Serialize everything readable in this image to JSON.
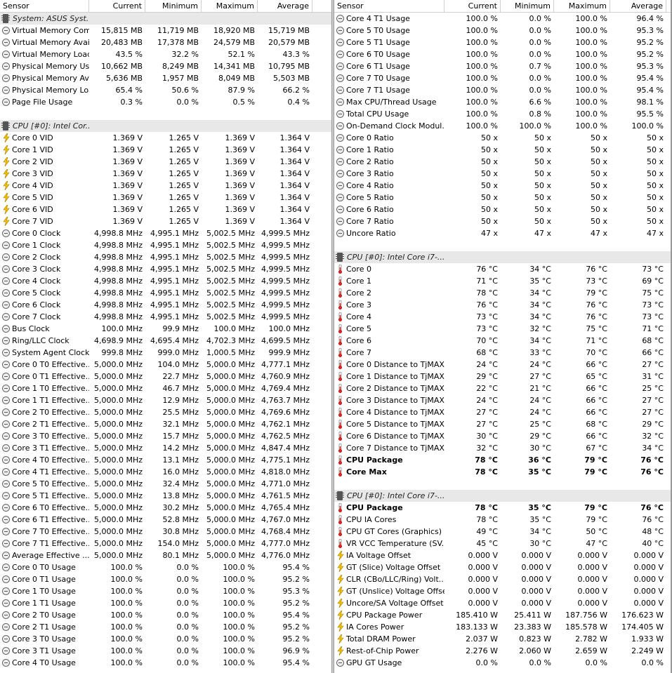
{
  "left": {
    "header": {
      "sensor": "Sensor",
      "current": "Current",
      "minimum": "Minimum",
      "maximum": "Maximum",
      "average": "Average"
    },
    "rows": [
      {
        "t": "group",
        "icon": "chip",
        "name": "System: ASUS Syst..."
      },
      {
        "icon": "circle",
        "name": "Virtual Memory Com...",
        "cur": "15,815 MB",
        "min": "11,719 MB",
        "max": "18,920 MB",
        "avg": "15,719 MB"
      },
      {
        "icon": "circle",
        "name": "Virtual Memory Avai...",
        "cur": "20,483 MB",
        "min": "17,378 MB",
        "max": "24,579 MB",
        "avg": "20,579 MB"
      },
      {
        "icon": "circle",
        "name": "Virtual Memory Load",
        "cur": "43.5 %",
        "min": "32.2 %",
        "max": "52.1 %",
        "avg": "43.3 %"
      },
      {
        "icon": "circle",
        "name": "Physical Memory Used",
        "cur": "10,662 MB",
        "min": "8,249 MB",
        "max": "14,341 MB",
        "avg": "10,795 MB"
      },
      {
        "icon": "circle",
        "name": "Physical Memory Av...",
        "cur": "5,636 MB",
        "min": "1,957 MB",
        "max": "8,049 MB",
        "avg": "5,503 MB"
      },
      {
        "icon": "circle",
        "name": "Physical Memory Load",
        "cur": "65.4 %",
        "min": "50.6 %",
        "max": "87.9 %",
        "avg": "66.2 %"
      },
      {
        "icon": "circle",
        "name": "Page File Usage",
        "cur": "0.3 %",
        "min": "0.0 %",
        "max": "0.5 %",
        "avg": "0.4 %"
      },
      {
        "t": "blank"
      },
      {
        "t": "group",
        "icon": "chip",
        "name": "CPU [#0]: Intel Cor..."
      },
      {
        "icon": "bolt",
        "name": "Core 0 VID",
        "cur": "1.369 V",
        "min": "1.265 V",
        "max": "1.369 V",
        "avg": "1.364 V"
      },
      {
        "icon": "bolt",
        "name": "Core 1 VID",
        "cur": "1.369 V",
        "min": "1.265 V",
        "max": "1.369 V",
        "avg": "1.364 V"
      },
      {
        "icon": "bolt",
        "name": "Core 2 VID",
        "cur": "1.369 V",
        "min": "1.265 V",
        "max": "1.369 V",
        "avg": "1.364 V"
      },
      {
        "icon": "bolt",
        "name": "Core 3 VID",
        "cur": "1.369 V",
        "min": "1.265 V",
        "max": "1.369 V",
        "avg": "1.364 V"
      },
      {
        "icon": "bolt",
        "name": "Core 4 VID",
        "cur": "1.369 V",
        "min": "1.265 V",
        "max": "1.369 V",
        "avg": "1.364 V"
      },
      {
        "icon": "bolt",
        "name": "Core 5 VID",
        "cur": "1.369 V",
        "min": "1.265 V",
        "max": "1.369 V",
        "avg": "1.364 V"
      },
      {
        "icon": "bolt",
        "name": "Core 6 VID",
        "cur": "1.369 V",
        "min": "1.265 V",
        "max": "1.369 V",
        "avg": "1.364 V"
      },
      {
        "icon": "bolt",
        "name": "Core 7 VID",
        "cur": "1.369 V",
        "min": "1.265 V",
        "max": "1.369 V",
        "avg": "1.364 V"
      },
      {
        "icon": "circle",
        "name": "Core 0 Clock",
        "cur": "4,998.8 MHz",
        "min": "4,995.1 MHz",
        "max": "5,002.5 MHz",
        "avg": "4,999.5 MHz"
      },
      {
        "icon": "circle",
        "name": "Core 1 Clock",
        "cur": "4,998.8 MHz",
        "min": "4,995.1 MHz",
        "max": "5,002.5 MHz",
        "avg": "4,999.5 MHz"
      },
      {
        "icon": "circle",
        "name": "Core 2 Clock",
        "cur": "4,998.8 MHz",
        "min": "4,995.1 MHz",
        "max": "5,002.5 MHz",
        "avg": "4,999.5 MHz"
      },
      {
        "icon": "circle",
        "name": "Core 3 Clock",
        "cur": "4,998.8 MHz",
        "min": "4,995.1 MHz",
        "max": "5,002.5 MHz",
        "avg": "4,999.5 MHz"
      },
      {
        "icon": "circle",
        "name": "Core 4 Clock",
        "cur": "4,998.8 MHz",
        "min": "4,995.1 MHz",
        "max": "5,002.5 MHz",
        "avg": "4,999.5 MHz"
      },
      {
        "icon": "circle",
        "name": "Core 5 Clock",
        "cur": "4,998.8 MHz",
        "min": "4,995.1 MHz",
        "max": "5,002.5 MHz",
        "avg": "4,999.5 MHz"
      },
      {
        "icon": "circle",
        "name": "Core 6 Clock",
        "cur": "4,998.8 MHz",
        "min": "4,995.1 MHz",
        "max": "5,002.5 MHz",
        "avg": "4,999.5 MHz"
      },
      {
        "icon": "circle",
        "name": "Core 7 Clock",
        "cur": "4,998.8 MHz",
        "min": "4,995.1 MHz",
        "max": "5,002.5 MHz",
        "avg": "4,999.5 MHz"
      },
      {
        "icon": "circle",
        "name": "Bus Clock",
        "cur": "100.0 MHz",
        "min": "99.9 MHz",
        "max": "100.0 MHz",
        "avg": "100.0 MHz"
      },
      {
        "icon": "circle",
        "name": "Ring/LLC Clock",
        "cur": "4,698.9 MHz",
        "min": "4,695.4 MHz",
        "max": "4,702.3 MHz",
        "avg": "4,699.5 MHz"
      },
      {
        "icon": "circle",
        "name": "System Agent Clock",
        "cur": "999.8 MHz",
        "min": "999.0 MHz",
        "max": "1,000.5 MHz",
        "avg": "999.9 MHz"
      },
      {
        "icon": "circle",
        "name": "Core 0 T0 Effective...",
        "cur": "5,000.0 MHz",
        "min": "104.0 MHz",
        "max": "5,000.0 MHz",
        "avg": "4,777.1 MHz"
      },
      {
        "icon": "circle",
        "name": "Core 0 T1 Effective...",
        "cur": "5,000.0 MHz",
        "min": "22.7 MHz",
        "max": "5,000.0 MHz",
        "avg": "4,760.9 MHz"
      },
      {
        "icon": "circle",
        "name": "Core 1 T0 Effective...",
        "cur": "5,000.0 MHz",
        "min": "46.7 MHz",
        "max": "5,000.0 MHz",
        "avg": "4,769.4 MHz"
      },
      {
        "icon": "circle",
        "name": "Core 1 T1 Effective...",
        "cur": "5,000.0 MHz",
        "min": "12.9 MHz",
        "max": "5,000.0 MHz",
        "avg": "4,763.7 MHz"
      },
      {
        "icon": "circle",
        "name": "Core 2 T0 Effective...",
        "cur": "5,000.0 MHz",
        "min": "25.5 MHz",
        "max": "5,000.0 MHz",
        "avg": "4,769.6 MHz"
      },
      {
        "icon": "circle",
        "name": "Core 2 T1 Effective...",
        "cur": "5,000.0 MHz",
        "min": "32.1 MHz",
        "max": "5,000.0 MHz",
        "avg": "4,762.1 MHz"
      },
      {
        "icon": "circle",
        "name": "Core 3 T0 Effective...",
        "cur": "5,000.0 MHz",
        "min": "15.7 MHz",
        "max": "5,000.0 MHz",
        "avg": "4,762.5 MHz"
      },
      {
        "icon": "circle",
        "name": "Core 3 T1 Effective...",
        "cur": "5,000.0 MHz",
        "min": "14.2 MHz",
        "max": "5,000.0 MHz",
        "avg": "4,847.4 MHz"
      },
      {
        "icon": "circle",
        "name": "Core 4 T0 Effective...",
        "cur": "5,000.0 MHz",
        "min": "13.1 MHz",
        "max": "5,000.0 MHz",
        "avg": "4,775.1 MHz"
      },
      {
        "icon": "circle",
        "name": "Core 4 T1 Effective...",
        "cur": "5,000.0 MHz",
        "min": "16.0 MHz",
        "max": "5,000.0 MHz",
        "avg": "4,818.0 MHz"
      },
      {
        "icon": "circle",
        "name": "Core 5 T0 Effective...",
        "cur": "5,000.0 MHz",
        "min": "32.4 MHz",
        "max": "5,000.0 MHz",
        "avg": "4,771.0 MHz"
      },
      {
        "icon": "circle",
        "name": "Core 5 T1 Effective...",
        "cur": "5,000.0 MHz",
        "min": "13.8 MHz",
        "max": "5,000.0 MHz",
        "avg": "4,761.5 MHz"
      },
      {
        "icon": "circle",
        "name": "Core 6 T0 Effective...",
        "cur": "5,000.0 MHz",
        "min": "30.2 MHz",
        "max": "5,000.0 MHz",
        "avg": "4,765.4 MHz"
      },
      {
        "icon": "circle",
        "name": "Core 6 T1 Effective...",
        "cur": "5,000.0 MHz",
        "min": "52.8 MHz",
        "max": "5,000.0 MHz",
        "avg": "4,767.0 MHz"
      },
      {
        "icon": "circle",
        "name": "Core 7 T0 Effective...",
        "cur": "5,000.0 MHz",
        "min": "30.8 MHz",
        "max": "5,000.0 MHz",
        "avg": "4,768.4 MHz"
      },
      {
        "icon": "circle",
        "name": "Core 7 T1 Effective...",
        "cur": "5,000.0 MHz",
        "min": "154.0 MHz",
        "max": "5,000.0 MHz",
        "avg": "4,777.0 MHz"
      },
      {
        "icon": "circle",
        "name": "Average Effective ...",
        "cur": "5,000.0 MHz",
        "min": "80.1 MHz",
        "max": "5,000.0 MHz",
        "avg": "4,776.0 MHz"
      },
      {
        "icon": "circle",
        "name": "Core 0 T0 Usage",
        "cur": "100.0 %",
        "min": "0.0 %",
        "max": "100.0 %",
        "avg": "95.4 %"
      },
      {
        "icon": "circle",
        "name": "Core 0 T1 Usage",
        "cur": "100.0 %",
        "min": "0.0 %",
        "max": "100.0 %",
        "avg": "95.2 %"
      },
      {
        "icon": "circle",
        "name": "Core 1 T0 Usage",
        "cur": "100.0 %",
        "min": "0.0 %",
        "max": "100.0 %",
        "avg": "95.3 %"
      },
      {
        "icon": "circle",
        "name": "Core 1 T1 Usage",
        "cur": "100.0 %",
        "min": "0.0 %",
        "max": "100.0 %",
        "avg": "95.2 %"
      },
      {
        "icon": "circle",
        "name": "Core 2 T0 Usage",
        "cur": "100.0 %",
        "min": "0.0 %",
        "max": "100.0 %",
        "avg": "95.4 %"
      },
      {
        "icon": "circle",
        "name": "Core 2 T1 Usage",
        "cur": "100.0 %",
        "min": "0.0 %",
        "max": "100.0 %",
        "avg": "95.2 %"
      },
      {
        "icon": "circle",
        "name": "Core 3 T0 Usage",
        "cur": "100.0 %",
        "min": "0.0 %",
        "max": "100.0 %",
        "avg": "95.2 %"
      },
      {
        "icon": "circle",
        "name": "Core 3 T1 Usage",
        "cur": "100.0 %",
        "min": "0.0 %",
        "max": "100.0 %",
        "avg": "96.9 %"
      },
      {
        "icon": "circle",
        "name": "Core 4 T0 Usage",
        "cur": "100.0 %",
        "min": "0.0 %",
        "max": "100.0 %",
        "avg": "95.4 %"
      }
    ]
  },
  "right": {
    "header": {
      "sensor": "Sensor",
      "current": "Current",
      "minimum": "Minimum",
      "maximum": "Maximum",
      "average": "Average"
    },
    "rows": [
      {
        "icon": "circle",
        "name": "Core 4 T1 Usage",
        "cur": "100.0 %",
        "min": "0.0 %",
        "max": "100.0 %",
        "avg": "96.4 %"
      },
      {
        "icon": "circle",
        "name": "Core 5 T0 Usage",
        "cur": "100.0 %",
        "min": "0.0 %",
        "max": "100.0 %",
        "avg": "95.3 %"
      },
      {
        "icon": "circle",
        "name": "Core 5 T1 Usage",
        "cur": "100.0 %",
        "min": "0.0 %",
        "max": "100.0 %",
        "avg": "95.2 %"
      },
      {
        "icon": "circle",
        "name": "Core 6 T0 Usage",
        "cur": "100.0 %",
        "min": "0.0 %",
        "max": "100.0 %",
        "avg": "95.2 %"
      },
      {
        "icon": "circle",
        "name": "Core 6 T1 Usage",
        "cur": "100.0 %",
        "min": "0.7 %",
        "max": "100.0 %",
        "avg": "95.3 %"
      },
      {
        "icon": "circle",
        "name": "Core 7 T0 Usage",
        "cur": "100.0 %",
        "min": "0.0 %",
        "max": "100.0 %",
        "avg": "95.4 %"
      },
      {
        "icon": "circle",
        "name": "Core 7 T1 Usage",
        "cur": "100.0 %",
        "min": "0.0 %",
        "max": "100.0 %",
        "avg": "95.4 %"
      },
      {
        "icon": "circle",
        "name": "Max CPU/Thread Usage",
        "cur": "100.0 %",
        "min": "6.6 %",
        "max": "100.0 %",
        "avg": "98.1 %"
      },
      {
        "icon": "circle",
        "name": "Total CPU Usage",
        "cur": "100.0 %",
        "min": "0.8 %",
        "max": "100.0 %",
        "avg": "95.5 %"
      },
      {
        "icon": "circle",
        "name": "On-Demand Clock Modul...",
        "cur": "100.0 %",
        "min": "100.0 %",
        "max": "100.0 %",
        "avg": "100.0 %"
      },
      {
        "icon": "circle",
        "name": "Core 0 Ratio",
        "cur": "50 x",
        "min": "50 x",
        "max": "50 x",
        "avg": "50 x"
      },
      {
        "icon": "circle",
        "name": "Core 1 Ratio",
        "cur": "50 x",
        "min": "50 x",
        "max": "50 x",
        "avg": "50 x"
      },
      {
        "icon": "circle",
        "name": "Core 2 Ratio",
        "cur": "50 x",
        "min": "50 x",
        "max": "50 x",
        "avg": "50 x"
      },
      {
        "icon": "circle",
        "name": "Core 3 Ratio",
        "cur": "50 x",
        "min": "50 x",
        "max": "50 x",
        "avg": "50 x"
      },
      {
        "icon": "circle",
        "name": "Core 4 Ratio",
        "cur": "50 x",
        "min": "50 x",
        "max": "50 x",
        "avg": "50 x"
      },
      {
        "icon": "circle",
        "name": "Core 5 Ratio",
        "cur": "50 x",
        "min": "50 x",
        "max": "50 x",
        "avg": "50 x"
      },
      {
        "icon": "circle",
        "name": "Core 6 Ratio",
        "cur": "50 x",
        "min": "50 x",
        "max": "50 x",
        "avg": "50 x"
      },
      {
        "icon": "circle",
        "name": "Core 7 Ratio",
        "cur": "50 x",
        "min": "50 x",
        "max": "50 x",
        "avg": "50 x"
      },
      {
        "icon": "circle",
        "name": "Uncore Ratio",
        "cur": "47 x",
        "min": "47 x",
        "max": "47 x",
        "avg": "47 x"
      },
      {
        "t": "blank"
      },
      {
        "t": "group",
        "icon": "chip",
        "name": "CPU [#0]: Intel Core i7-..."
      },
      {
        "icon": "therm",
        "name": "Core 0",
        "cur": "76 °C",
        "min": "34 °C",
        "max": "76 °C",
        "avg": "73 °C"
      },
      {
        "icon": "therm",
        "name": "Core 1",
        "cur": "71 °C",
        "min": "35 °C",
        "max": "73 °C",
        "avg": "69 °C"
      },
      {
        "icon": "therm",
        "name": "Core 2",
        "cur": "78 °C",
        "min": "34 °C",
        "max": "79 °C",
        "avg": "75 °C"
      },
      {
        "icon": "therm",
        "name": "Core 3",
        "cur": "76 °C",
        "min": "34 °C",
        "max": "76 °C",
        "avg": "73 °C"
      },
      {
        "icon": "therm",
        "name": "Core 4",
        "cur": "73 °C",
        "min": "34 °C",
        "max": "76 °C",
        "avg": "73 °C"
      },
      {
        "icon": "therm",
        "name": "Core 5",
        "cur": "73 °C",
        "min": "32 °C",
        "max": "75 °C",
        "avg": "71 °C"
      },
      {
        "icon": "therm",
        "name": "Core 6",
        "cur": "70 °C",
        "min": "34 °C",
        "max": "71 °C",
        "avg": "68 °C"
      },
      {
        "icon": "therm",
        "name": "Core 7",
        "cur": "68 °C",
        "min": "33 °C",
        "max": "70 °C",
        "avg": "66 °C"
      },
      {
        "icon": "therm",
        "name": "Core 0 Distance to TjMAX",
        "cur": "24 °C",
        "min": "24 °C",
        "max": "66 °C",
        "avg": "27 °C"
      },
      {
        "icon": "therm",
        "name": "Core 1 Distance to TjMAX",
        "cur": "29 °C",
        "min": "27 °C",
        "max": "65 °C",
        "avg": "31 °C"
      },
      {
        "icon": "therm",
        "name": "Core 2 Distance to TjMAX",
        "cur": "22 °C",
        "min": "21 °C",
        "max": "66 °C",
        "avg": "25 °C"
      },
      {
        "icon": "therm",
        "name": "Core 3 Distance to TjMAX",
        "cur": "24 °C",
        "min": "24 °C",
        "max": "66 °C",
        "avg": "27 °C"
      },
      {
        "icon": "therm",
        "name": "Core 4 Distance to TjMAX",
        "cur": "27 °C",
        "min": "24 °C",
        "max": "66 °C",
        "avg": "27 °C"
      },
      {
        "icon": "therm",
        "name": "Core 5 Distance to TjMAX",
        "cur": "27 °C",
        "min": "25 °C",
        "max": "68 °C",
        "avg": "29 °C"
      },
      {
        "icon": "therm",
        "name": "Core 6 Distance to TjMAX",
        "cur": "30 °C",
        "min": "29 °C",
        "max": "66 °C",
        "avg": "32 °C"
      },
      {
        "icon": "therm",
        "name": "Core 7 Distance to TjMAX",
        "cur": "32 °C",
        "min": "30 °C",
        "max": "67 °C",
        "avg": "34 °C"
      },
      {
        "t": "bold",
        "icon": "therm",
        "name": "CPU Package",
        "cur": "78 °C",
        "min": "36 °C",
        "max": "79 °C",
        "avg": "76 °C"
      },
      {
        "t": "bold",
        "icon": "therm",
        "name": "Core Max",
        "cur": "78 °C",
        "min": "35 °C",
        "max": "79 °C",
        "avg": "76 °C"
      },
      {
        "t": "blank"
      },
      {
        "t": "group",
        "icon": "chip",
        "name": "CPU [#0]: Intel Core i7-..."
      },
      {
        "t": "bold",
        "icon": "therm",
        "name": "CPU Package",
        "cur": "78 °C",
        "min": "35 °C",
        "max": "79 °C",
        "avg": "76 °C"
      },
      {
        "icon": "therm",
        "name": "CPU IA Cores",
        "cur": "78 °C",
        "min": "35 °C",
        "max": "79 °C",
        "avg": "76 °C"
      },
      {
        "icon": "therm",
        "name": "CPU GT Cores (Graphics)",
        "cur": "49 °C",
        "min": "34 °C",
        "max": "50 °C",
        "avg": "48 °C"
      },
      {
        "icon": "therm",
        "name": "VR VCC Temperature (SV...",
        "cur": "45 °C",
        "min": "30 °C",
        "max": "47 °C",
        "avg": "40 °C"
      },
      {
        "icon": "bolt",
        "name": "IA Voltage Offset",
        "cur": "0.000 V",
        "min": "0.000 V",
        "max": "0.000 V",
        "avg": "0.000 V"
      },
      {
        "icon": "bolt",
        "name": "GT (Slice) Voltage Offset",
        "cur": "0.000 V",
        "min": "0.000 V",
        "max": "0.000 V",
        "avg": "0.000 V"
      },
      {
        "icon": "bolt",
        "name": "CLR (CBo/LLC/Ring) Volt...",
        "cur": "0.000 V",
        "min": "0.000 V",
        "max": "0.000 V",
        "avg": "0.000 V"
      },
      {
        "icon": "bolt",
        "name": "GT (Unslice) Voltage Offset",
        "cur": "0.000 V",
        "min": "0.000 V",
        "max": "0.000 V",
        "avg": "0.000 V"
      },
      {
        "icon": "bolt",
        "name": "Uncore/SA Voltage Offset",
        "cur": "0.000 V",
        "min": "0.000 V",
        "max": "0.000 V",
        "avg": "0.000 V"
      },
      {
        "icon": "bolt",
        "name": "CPU Package Power",
        "cur": "185.410 W",
        "min": "25.411 W",
        "max": "187.756 W",
        "avg": "176.623 W"
      },
      {
        "icon": "bolt",
        "name": "IA Cores Power",
        "cur": "183.133 W",
        "min": "23.383 W",
        "max": "185.578 W",
        "avg": "174.405 W"
      },
      {
        "icon": "bolt",
        "name": "Total DRAM Power",
        "cur": "2.037 W",
        "min": "0.823 W",
        "max": "2.782 W",
        "avg": "1.933 W"
      },
      {
        "icon": "bolt",
        "name": "Rest-of-Chip Power",
        "cur": "2.276 W",
        "min": "2.060 W",
        "max": "2.659 W",
        "avg": "2.249 W"
      },
      {
        "icon": "circle",
        "name": "GPU GT Usage",
        "cur": "0.0 %",
        "min": "0.0 %",
        "max": "0.0 %",
        "avg": "0.0 %"
      }
    ]
  }
}
